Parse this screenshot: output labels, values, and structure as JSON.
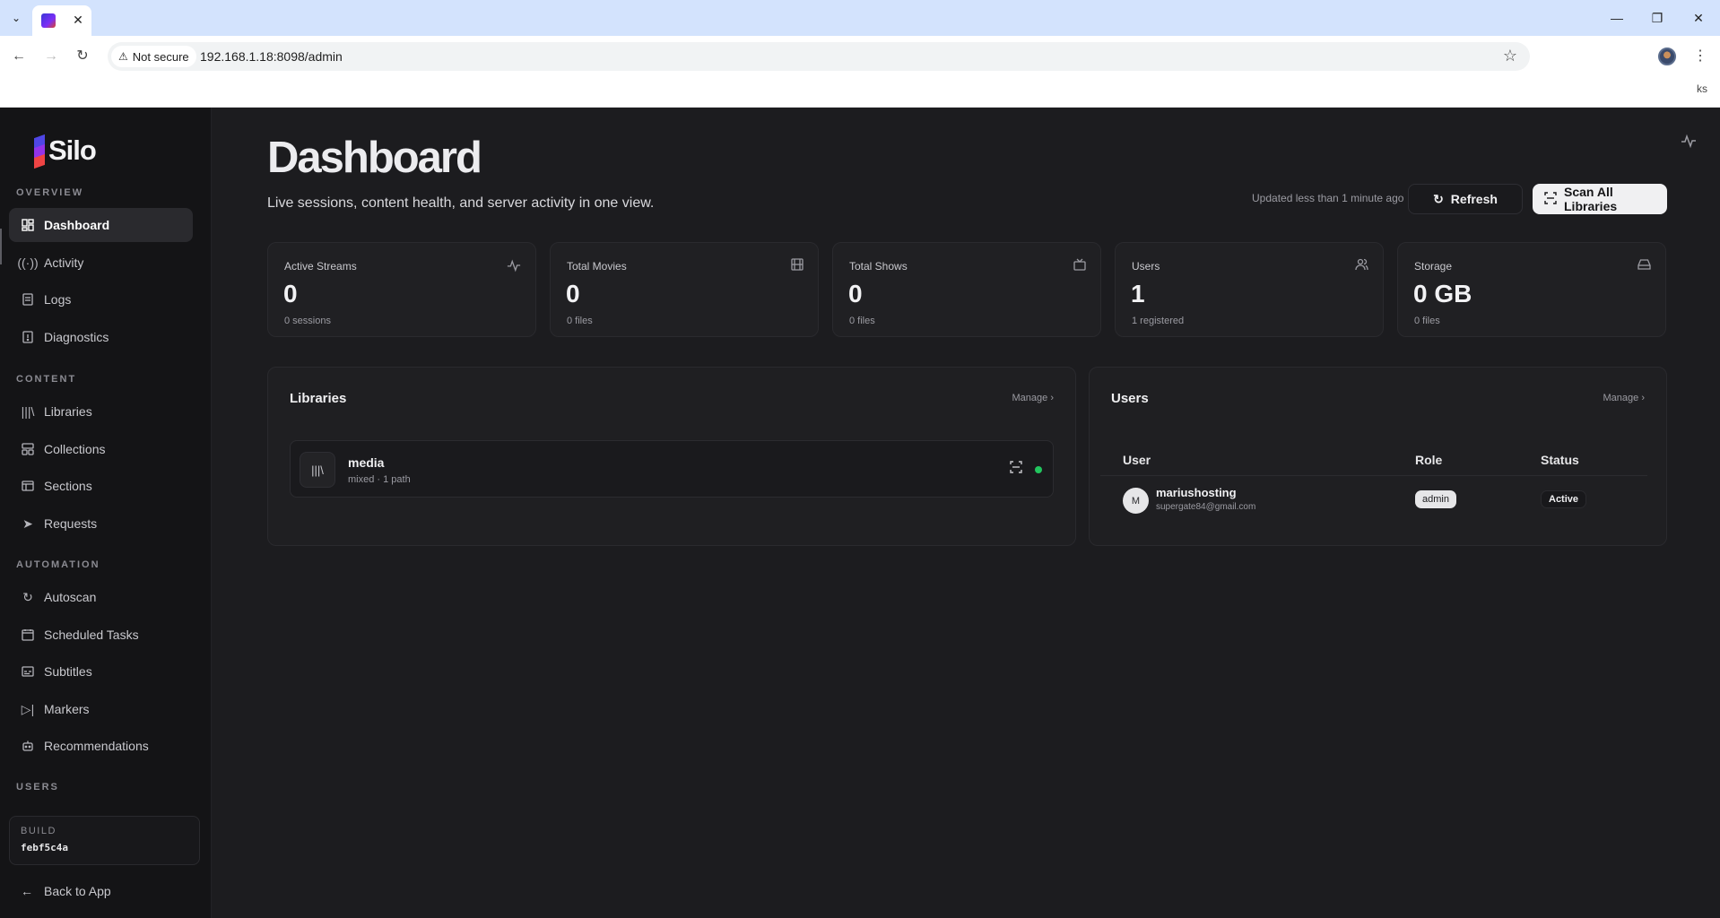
{
  "browser": {
    "tab_close": "✕",
    "security_label": "Not secure",
    "url": "192.168.1.18:8098/admin",
    "extension_text": "ks"
  },
  "sidebar": {
    "brand": "Silo",
    "brand_colors": [
      "#4f46e5",
      "#9333ea",
      "#ef4444"
    ],
    "sections": [
      {
        "label": "OVERVIEW",
        "items": [
          {
            "label": "Dashboard",
            "icon": "dashboard-icon",
            "active": true
          },
          {
            "label": "Activity",
            "icon": "broadcast-icon"
          },
          {
            "label": "Logs",
            "icon": "logs-icon"
          },
          {
            "label": "Diagnostics",
            "icon": "diagnostics-icon"
          }
        ]
      },
      {
        "label": "CONTENT",
        "items": [
          {
            "label": "Libraries",
            "icon": "library-icon"
          },
          {
            "label": "Collections",
            "icon": "collections-icon"
          },
          {
            "label": "Sections",
            "icon": "sections-icon"
          },
          {
            "label": "Requests",
            "icon": "send-icon"
          }
        ]
      },
      {
        "label": "AUTOMATION",
        "items": [
          {
            "label": "Autoscan",
            "icon": "refresh-icon"
          },
          {
            "label": "Scheduled Tasks",
            "icon": "calendar-icon"
          },
          {
            "label": "Subtitles",
            "icon": "subtitles-icon"
          },
          {
            "label": "Markers",
            "icon": "markers-icon"
          },
          {
            "label": "Recommendations",
            "icon": "bot-icon"
          }
        ]
      },
      {
        "label": "USERS",
        "items": []
      }
    ],
    "build_label": "BUILD",
    "build_value": "febf5c4a",
    "back_label": "Back to App"
  },
  "header": {
    "title": "Dashboard",
    "subtitle": "Live sessions, content health, and server activity in one view.",
    "updated": "Updated less than 1 minute ago",
    "refresh_label": "Refresh",
    "scan_label": "Scan All Libraries"
  },
  "stats": [
    {
      "label": "Active Streams",
      "value": "0",
      "sub": "0 sessions",
      "icon": "pulse-icon"
    },
    {
      "label": "Total Movies",
      "value": "0",
      "sub": "0 files",
      "icon": "film-icon"
    },
    {
      "label": "Total Shows",
      "value": "0",
      "sub": "0 files",
      "icon": "tv-icon"
    },
    {
      "label": "Users",
      "value": "1",
      "sub": "1 registered",
      "icon": "users-icon"
    },
    {
      "label": "Storage",
      "value": "0 GB",
      "sub": "0 files",
      "icon": "drive-icon"
    }
  ],
  "libraries_panel": {
    "title": "Libraries",
    "manage": "Manage ›",
    "items": [
      {
        "name": "media",
        "meta": "mixed · 1 path",
        "status_color": "#22c55e"
      }
    ]
  },
  "users_panel": {
    "title": "Users",
    "manage": "Manage ›",
    "columns": [
      "User",
      "Role",
      "Status"
    ],
    "rows": [
      {
        "initial": "M",
        "name": "mariushosting",
        "email": "supergate84@gmail.com",
        "role": "admin",
        "status": "Active"
      }
    ]
  }
}
